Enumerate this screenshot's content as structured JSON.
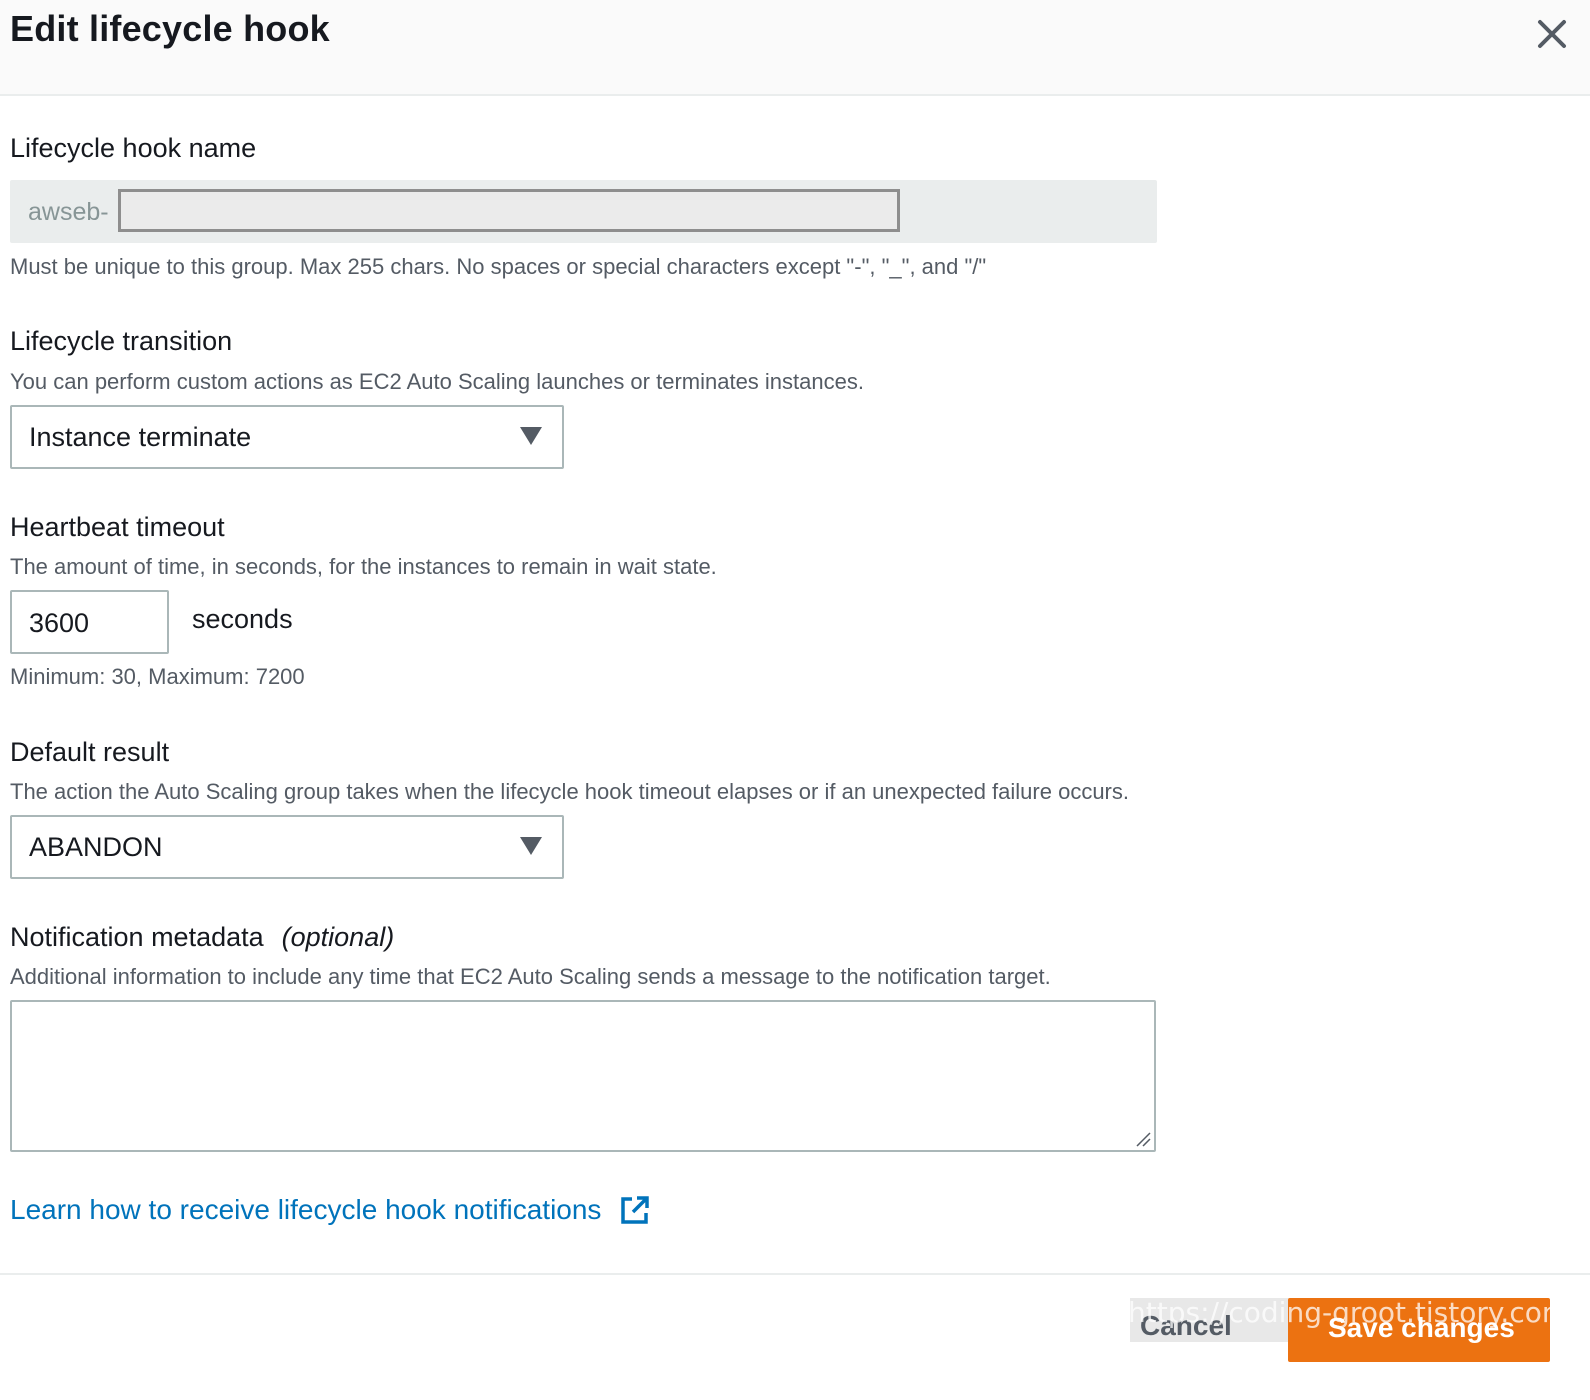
{
  "modal": {
    "title": "Edit lifecycle hook"
  },
  "hook_name": {
    "label": "Lifecycle hook name",
    "value_prefix": "awseb-",
    "hint": "Must be unique to this group. Max 255 chars. No spaces or special characters except \"-\", \"_\", and \"/\""
  },
  "transition": {
    "label": "Lifecycle transition",
    "description": "You can perform custom actions as EC2 Auto Scaling launches or terminates instances.",
    "selected": "Instance terminate"
  },
  "heartbeat": {
    "label": "Heartbeat timeout",
    "description": "The amount of time, in seconds, for the instances to remain in wait state.",
    "value": "3600",
    "unit": "seconds",
    "hint": "Minimum: 30, Maximum: 7200"
  },
  "default_result": {
    "label": "Default result",
    "description": "The action the Auto Scaling group takes when the lifecycle hook timeout elapses or if an unexpected failure occurs.",
    "selected": "ABANDON"
  },
  "metadata": {
    "label": "Notification metadata",
    "optional": "(optional)",
    "description": "Additional information to include any time that EC2 Auto Scaling sends a message to the notification target.",
    "value": ""
  },
  "learn_link": {
    "text": "Learn how to receive lifecycle hook notifications",
    "icon": "external-link-icon"
  },
  "footer": {
    "cancel_label": "Cancel",
    "save_label": "Save changes",
    "watermark": "https://coding-groot.tistory.com"
  },
  "colors": {
    "primary": "#ec7211",
    "link": "#0073bb",
    "text": "#16191f",
    "secondary_text": "#545b64",
    "border": "#aab7b8"
  }
}
